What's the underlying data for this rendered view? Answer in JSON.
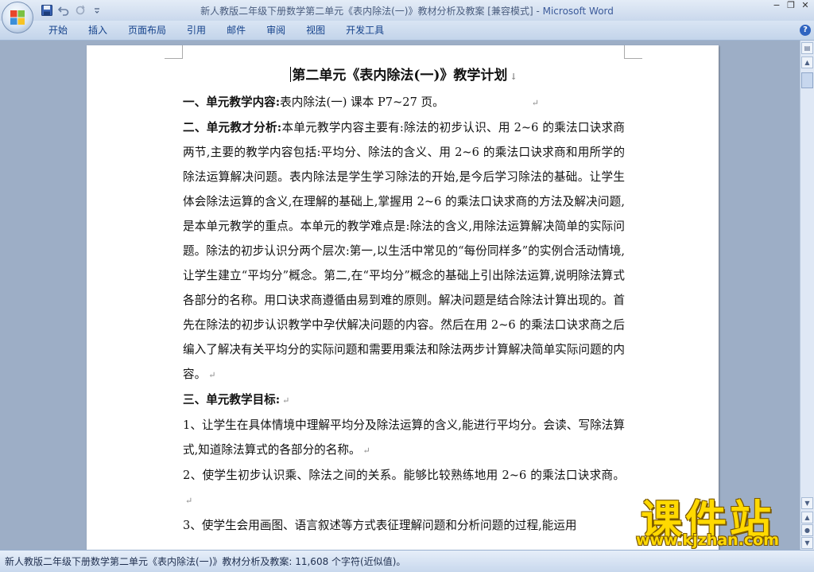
{
  "window": {
    "doc_name": "新人教版二年级下册数学第二单元《表内除法(一)》教材分析及教案 [兼容模式]",
    "separator": " - ",
    "app_name": "Microsoft Word",
    "minimize": "−",
    "restore": "❐",
    "close": "✕"
  },
  "ribbon": {
    "tabs": [
      "开始",
      "插入",
      "页面布局",
      "引用",
      "邮件",
      "审阅",
      "视图",
      "开发工具"
    ],
    "help": "?"
  },
  "document": {
    "title": "第二单元《表内除法(一)》教学计划",
    "section1": {
      "label": "一、单元教学内容:",
      "text": "表内除法(一)   课本 P7~27 页。"
    },
    "section2": {
      "label": "二、单元教才分析:",
      "text": "本单元教学内容主要有:除法的初步认识、用 2~6 的乘法口诀求商两节,主要的教学内容包括:平均分、除法的含义、用 2~6 的乘法口诀求商和用所学的除法运算解决问题。表内除法是学生学习除法的开始,是今后学习除法的基础。让学生体会除法运算的含义,在理解的基础上,掌握用 2~6 的乘法口诀求商的方法及解决问题,是本单元教学的重点。本单元的教学难点是:除法的含义,用除法运算解决简单的实际问题。除法的初步认识分两个层次:第一,以生活中常见的“每份同样多”的实例合活动情境,让学生建立“平均分”概念。第二,在“平均分”概念的基础上引出除法运算,说明除法算式各部分的名称。用口诀求商遵循由易到难的原则。解决问题是结合除法计算出现的。首先在除法的初步认识教学中孕伏解决问题的内容。然后在用 2~6 的乘法口诀求商之后编入了解决有关平均分的实际问题和需要用乘法和除法两步计算解决简单实际问题的内容。"
    },
    "section3": {
      "label": "三、单元教学目标:"
    },
    "goal1": "1、让学生在具体情境中理解平均分及除法运算的含义,能进行平均分。会读、写除法算式,知道除法算式的各部分的名称。",
    "goal2": "2、使学生初步认识乘、除法之间的关系。能够比较熟练地用 2~6 的乘法口诀求商。",
    "goal3": "3、使学生会用画图、语言叙述等方式表征理解问题和分析问题的过程,能运用",
    "para_mark": "↵",
    "title_mark": "↓"
  },
  "status": {
    "text": "新人教版二年级下册数学第二单元《表内除法(一)》教材分析及教案: 11,608 个字符(近似值)。"
  },
  "watermark": {
    "brand": "课件站",
    "url": "www.kjzhan.com"
  },
  "icons": {
    "office": "office-logo-icon",
    "save": "save-icon",
    "undo": "undo-icon",
    "redo": "redo-icon",
    "customize": "chevron-down-icon"
  }
}
